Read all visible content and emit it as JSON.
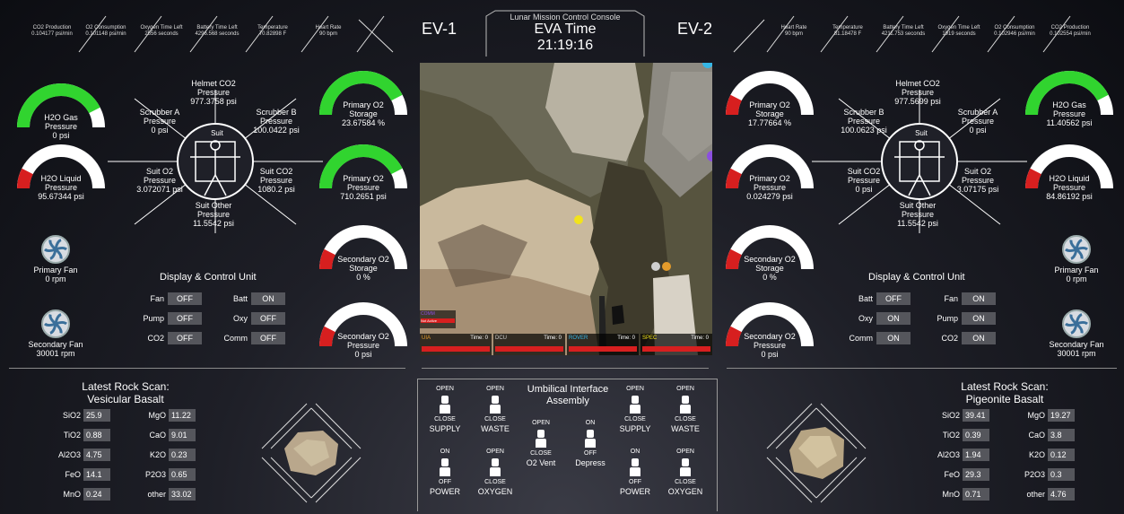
{
  "header": {
    "subtitle": "Lunar Mission Control Console",
    "title": "EVA Time",
    "time": "21:19:16",
    "ev1": "EV-1",
    "ev2": "EV-2"
  },
  "ev1": {
    "telemetry": [
      {
        "name": "CO2 Production",
        "value": "0.104177 psi/min"
      },
      {
        "name": "O2 Consumption",
        "value": "0.101148 psi/min"
      },
      {
        "name": "Oxygen Time Left",
        "value": "2556 seconds"
      },
      {
        "name": "Battery Time Left",
        "value": "4296.568 seconds"
      },
      {
        "name": "Temperature",
        "value": "70.82898 F"
      },
      {
        "name": "Heart Rate",
        "value": "90 bpm"
      }
    ],
    "gauges": {
      "h2o_gas": {
        "l1": "H2O Gas",
        "l2": "Pressure",
        "v": "0 psi",
        "fill": 0.85
      },
      "h2o_liquid": {
        "l1": "H2O Liquid",
        "l2": "Pressure",
        "v": "95.67344 psi",
        "fill": 0.15
      },
      "primary_o2_storage": {
        "l1": "Primary O2",
        "l2": "Storage",
        "v": "23.67584 %",
        "fill": 0.85
      },
      "primary_o2_pressure": {
        "l1": "Primary O2",
        "l2": "Pressure",
        "v": "710.2651 psi",
        "fill": 0.85
      },
      "secondary_o2_storage": {
        "l1": "Secondary O2",
        "l2": "Storage",
        "v": "0 %",
        "fill": 0.15
      },
      "secondary_o2_pressure": {
        "l1": "Secondary O2",
        "l2": "Pressure",
        "v": "0 psi",
        "fill": 0.15
      }
    },
    "sensors": {
      "helmet_co2": {
        "l1": "Helmet CO2",
        "l2": "Pressure",
        "v": "977.3758 psi"
      },
      "scrubber_a": {
        "l1": "Scrubber A",
        "l2": "Pressure",
        "v": "0 psi"
      },
      "scrubber_b": {
        "l1": "Scrubber B",
        "l2": "Pressure",
        "v": "100.0422 psi"
      },
      "suit_o2": {
        "l1": "Suit O2",
        "l2": "Pressure",
        "v": "3.072071 psi"
      },
      "suit_co2": {
        "l1": "Suit CO2",
        "l2": "Pressure",
        "v": "1080.2 psi"
      },
      "suit_other": {
        "l1": "Suit Other",
        "l2": "Pressure",
        "v": "11.5542 psi"
      },
      "suit": "Suit"
    },
    "fans": {
      "primary": {
        "label": "Primary Fan",
        "v": "0 rpm"
      },
      "secondary": {
        "label": "Secondary Fan",
        "v": "30001 rpm"
      }
    },
    "dcu": {
      "title": "Display & Control Unit",
      "items": [
        {
          "k": "Fan",
          "v": "OFF"
        },
        {
          "k": "Batt",
          "v": "ON"
        },
        {
          "k": "Pump",
          "v": "OFF"
        },
        {
          "k": "Oxy",
          "v": "OFF"
        },
        {
          "k": "CO2",
          "v": "OFF"
        },
        {
          "k": "Comm",
          "v": "OFF"
        }
      ]
    },
    "rock": {
      "t1": "Latest Rock Scan:",
      "t2": "Vesicular Basalt",
      "items": [
        {
          "k": "SiO2",
          "v": "25.9"
        },
        {
          "k": "MgO",
          "v": "11.22"
        },
        {
          "k": "TiO2",
          "v": "0.88"
        },
        {
          "k": "CaO",
          "v": "9.01"
        },
        {
          "k": "Al2O3",
          "v": "4.75"
        },
        {
          "k": "K2O",
          "v": "0.23"
        },
        {
          "k": "FeO",
          "v": "14.1"
        },
        {
          "k": "P2O3",
          "v": "0.65"
        },
        {
          "k": "MnO",
          "v": "0.24"
        },
        {
          "k": "other",
          "v": "33.02"
        }
      ]
    }
  },
  "ev2": {
    "telemetry": [
      {
        "name": "Heart Rate",
        "value": "90 bpm"
      },
      {
        "name": "Temperature",
        "value": "81.18478 F"
      },
      {
        "name": "Battery Time Left",
        "value": "4211.753 seconds"
      },
      {
        "name": "Oxygen Time Left",
        "value": "1919 seconds"
      },
      {
        "name": "O2 Consumption",
        "value": "0.102946 psi/min"
      },
      {
        "name": "CO2 Production",
        "value": "0.102554 psi/min"
      }
    ],
    "gauges": {
      "primary_o2_storage": {
        "l1": "Primary O2",
        "l2": "Storage",
        "v": "17.77664 %",
        "fill": 0.15
      },
      "primary_o2_pressure": {
        "l1": "Primary O2",
        "l2": "Pressure",
        "v": "0.024279 psi",
        "fill": 0.15
      },
      "secondary_o2_storage": {
        "l1": "Secondary O2",
        "l2": "Storage",
        "v": "0 %",
        "fill": 0.15
      },
      "secondary_o2_pressure": {
        "l1": "Secondary O2",
        "l2": "Pressure",
        "v": "0 psi",
        "fill": 0.15
      },
      "h2o_gas": {
        "l1": "H2O Gas",
        "l2": "Pressure",
        "v": "11.40562 psi",
        "fill": 0.85
      },
      "h2o_liquid": {
        "l1": "H2O Liquid",
        "l2": "Pressure",
        "v": "84.86192 psi",
        "fill": 0.15
      }
    },
    "sensors": {
      "helmet_co2": {
        "l1": "Helmet CO2",
        "l2": "Pressure",
        "v": "977.5699 psi"
      },
      "scrubber_b": {
        "l1": "Scrubber B",
        "l2": "Pressure",
        "v": "100.0623 psi"
      },
      "scrubber_a": {
        "l1": "Scrubber A",
        "l2": "Pressure",
        "v": "0 psi"
      },
      "suit_co2": {
        "l1": "Suit CO2",
        "l2": "Pressure",
        "v": "0 psi"
      },
      "suit_o2": {
        "l1": "Suit O2",
        "l2": "Pressure",
        "v": "3.07175 psi"
      },
      "suit_other": {
        "l1": "Suit Other",
        "l2": "Pressure",
        "v": "11.5542 psi"
      },
      "suit": "Suit"
    },
    "fans": {
      "primary": {
        "label": "Primary Fan",
        "v": "0 rpm"
      },
      "secondary": {
        "label": "Secondary Fan",
        "v": "30001 rpm"
      }
    },
    "dcu": {
      "title": "Display & Control Unit",
      "items": [
        {
          "k": "Batt",
          "v": "OFF"
        },
        {
          "k": "Fan",
          "v": "ON"
        },
        {
          "k": "Oxy",
          "v": "ON"
        },
        {
          "k": "Pump",
          "v": "ON"
        },
        {
          "k": "Comm",
          "v": "ON"
        },
        {
          "k": "CO2",
          "v": "ON"
        }
      ]
    },
    "rock": {
      "t1": "Latest Rock Scan:",
      "t2": "Pigeonite Basalt",
      "items": [
        {
          "k": "SiO2",
          "v": "39.41"
        },
        {
          "k": "MgO",
          "v": "19.27"
        },
        {
          "k": "TiO2",
          "v": "0.39"
        },
        {
          "k": "CaO",
          "v": "3.8"
        },
        {
          "k": "Al2O3",
          "v": "1.94"
        },
        {
          "k": "K2O",
          "v": "0.12"
        },
        {
          "k": "FeO",
          "v": "29.3"
        },
        {
          "k": "P2O3",
          "v": "0.3"
        },
        {
          "k": "MnO",
          "v": "0.71"
        },
        {
          "k": "other",
          "v": "4.76"
        }
      ]
    }
  },
  "uia": {
    "title1": "Umbilical Interface",
    "title2": "Assembly",
    "switches": [
      {
        "top": "OPEN",
        "bottom": "CLOSE",
        "cap": "SUPPLY"
      },
      {
        "top": "OPEN",
        "bottom": "CLOSE",
        "cap": "WASTE"
      },
      {
        "top": "ON",
        "bottom": "OFF",
        "cap": "POWER"
      },
      {
        "top": "OPEN",
        "bottom": "CLOSE",
        "cap": "OXYGEN"
      },
      {
        "top": "OPEN",
        "bottom": "CLOSE",
        "cap": "O2 Vent"
      },
      {
        "top": "ON",
        "bottom": "OFF",
        "cap": "Depress"
      },
      {
        "top": "OPEN",
        "bottom": "CLOSE",
        "cap": "SUPPLY"
      },
      {
        "top": "OPEN",
        "bottom": "CLOSE",
        "cap": "WASTE"
      },
      {
        "top": "ON",
        "bottom": "OFF",
        "cap": "POWER"
      },
      {
        "top": "OPEN",
        "bottom": "CLOSE",
        "cap": "OXYGEN"
      }
    ]
  },
  "map": {
    "comm_label": "COMM",
    "comm_status": "Not Active",
    "panels": [
      {
        "name": "UIA",
        "time": "Time: 0",
        "color": "#e39b2b"
      },
      {
        "name": "DCU",
        "time": "Time: 0",
        "color": "#cfcfcf"
      },
      {
        "name": "ROVER",
        "time": "Time: 0",
        "color": "#35b6e6"
      },
      {
        "name": "SPEC",
        "time": "Time: 0",
        "color": "#f2e31b"
      }
    ]
  },
  "colors": {
    "green": "#31d42f",
    "red": "#d71f1f",
    "toggle": "#55565c"
  }
}
